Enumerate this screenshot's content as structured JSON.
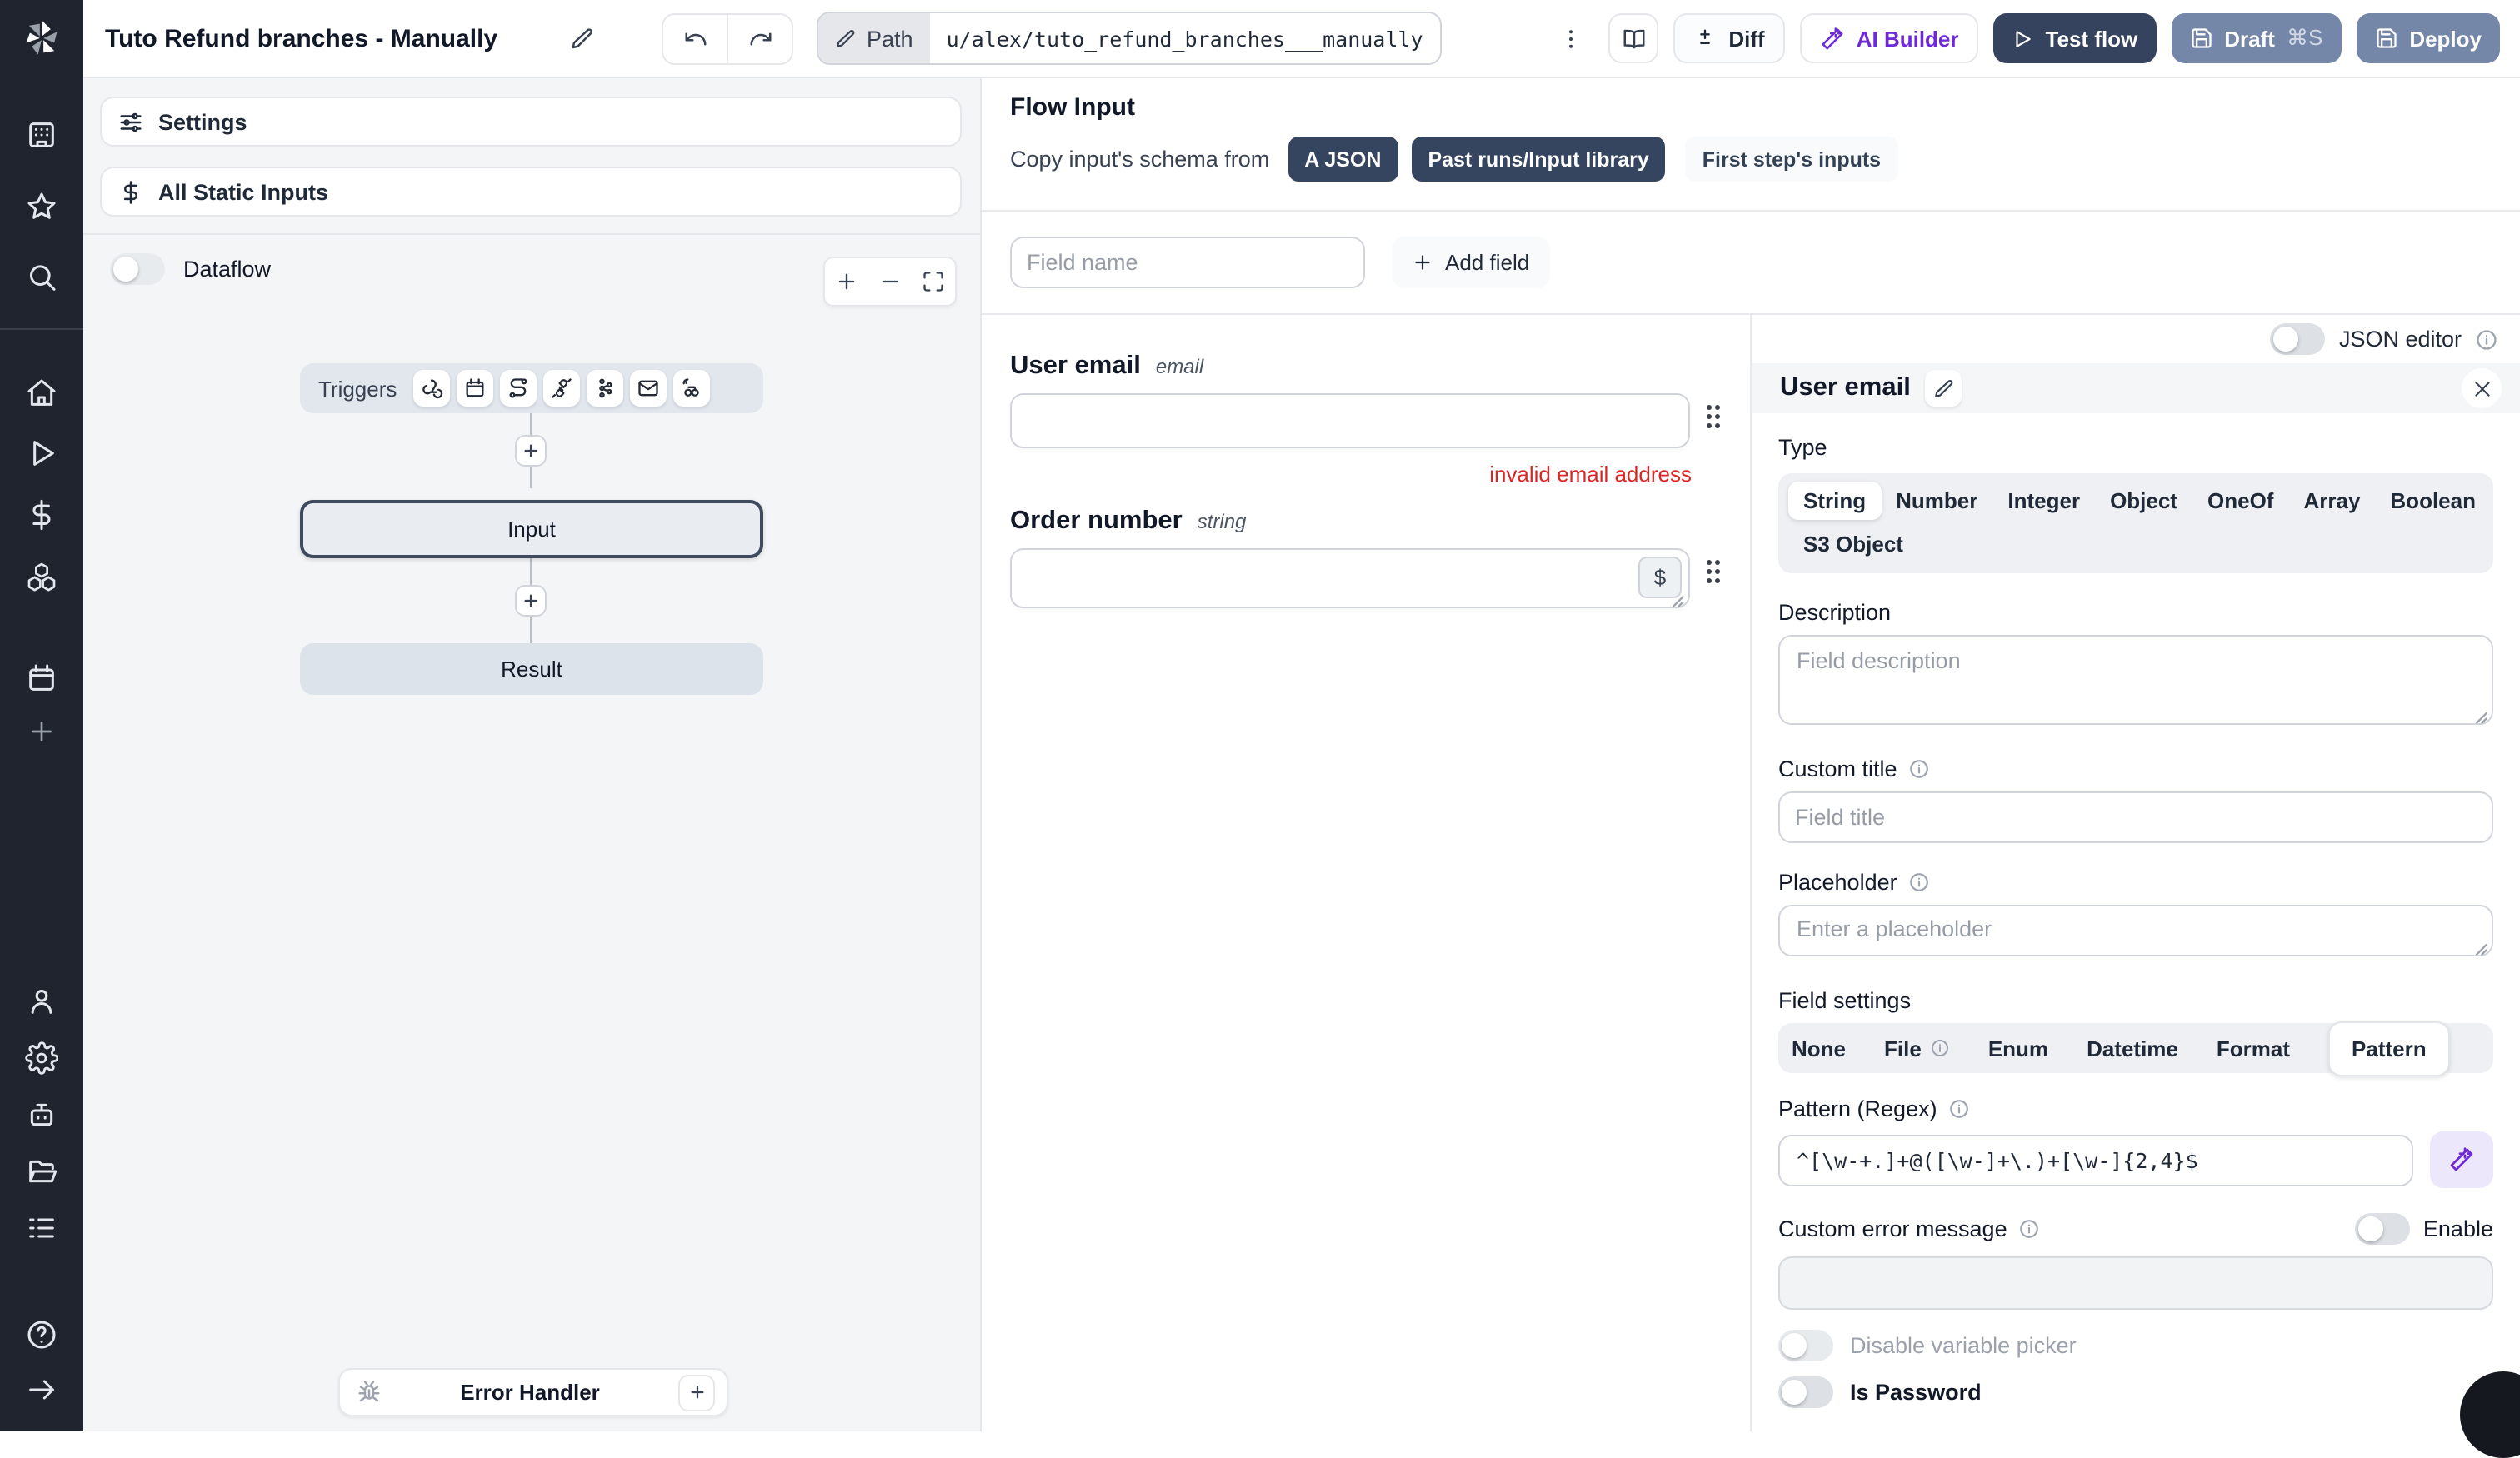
{
  "topbar": {
    "title": "Tuto Refund branches - Manually",
    "path_label": "Path",
    "path_value": "u/alex/tuto_refund_branches___manually",
    "diff_label": "Diff",
    "ai_builder_label": "AI Builder",
    "test_flow_label": "Test flow",
    "draft_label": "Draft",
    "draft_shortcut": "⌘S",
    "deploy_label": "Deploy"
  },
  "flow_panel": {
    "settings_label": "Settings",
    "static_inputs_label": "All Static Inputs",
    "dataflow_label": "Dataflow",
    "triggers_label": "Triggers",
    "input_node_label": "Input",
    "result_node_label": "Result",
    "error_handler_label": "Error Handler"
  },
  "flow_input": {
    "title": "Flow Input",
    "copy_schema_label": "Copy input's schema from",
    "copy_options": [
      "A JSON",
      "Past runs/Input library",
      "First step's inputs"
    ],
    "field_name_placeholder": "Field name",
    "add_field_label": "Add field",
    "fields": [
      {
        "label": "User email",
        "type": "email",
        "error": "invalid email address"
      },
      {
        "label": "Order number",
        "type": "string",
        "variable_button": "$"
      }
    ]
  },
  "editor": {
    "json_editor_label": "JSON editor",
    "selected_field": "User email",
    "type_label": "Type",
    "types": [
      "String",
      "Number",
      "Integer",
      "Object",
      "OneOf",
      "Array",
      "Boolean",
      "S3 Object"
    ],
    "selected_type": "String",
    "description_label": "Description",
    "description_placeholder": "Field description",
    "custom_title_label": "Custom title",
    "custom_title_placeholder": "Field title",
    "placeholder_label": "Placeholder",
    "placeholder_placeholder": "Enter a placeholder",
    "field_settings_label": "Field settings",
    "field_settings_tabs": [
      "None",
      "File",
      "Enum",
      "Datetime",
      "Format",
      "Pattern"
    ],
    "selected_field_setting": "Pattern",
    "pattern_label": "Pattern (Regex)",
    "pattern_value": "^[\\w-+.]+@([\\w-]+\\.)+[\\w-]{2,4}$",
    "custom_error_label": "Custom error message",
    "enable_label": "Enable",
    "disable_variable_picker_label": "Disable variable picker",
    "is_password_label": "Is Password"
  },
  "colors": {
    "accent_dark": "#36435f",
    "accent_slate": "#7487a9",
    "ai_purple": "#6d28d9",
    "error_red": "#dc2626",
    "sidebar_bg": "#20242e"
  },
  "icons": {
    "sidebar": [
      "windmill-logo",
      "workspace",
      "favorites",
      "search",
      "home",
      "runs",
      "variables",
      "resources",
      "schedules",
      "add",
      "user",
      "settings",
      "workers",
      "folders",
      "logs",
      "help",
      "expand"
    ],
    "triggers": [
      "webhook",
      "schedule",
      "http-route",
      "websocket",
      "kafka",
      "email",
      "poll"
    ]
  }
}
